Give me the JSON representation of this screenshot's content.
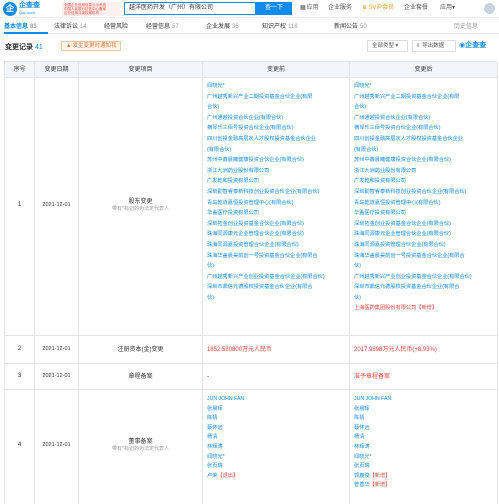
{
  "header": {
    "logo_mark": "企",
    "logo_name": "企查查",
    "logo_site": "Qcc.com",
    "badge_lines": [
      "全国企业信用信息公示系统",
      "中国人民银行征信中心备案",
      "企业信用评级权威机构"
    ],
    "search_value": "越洋医药开发（广州）有限公司",
    "search_button": "查一下",
    "nav": [
      "应用",
      "企业服务",
      "SVIP会员",
      "企业套餐",
      "应用"
    ],
    "nav_icons": {
      "app": "grid-icon",
      "svip": "crown-icon"
    }
  },
  "tabs": [
    {
      "label": "基本信息",
      "count": "83"
    },
    {
      "label": "法律诉讼",
      "count": "14"
    },
    {
      "label": "经营风险",
      "count": ""
    },
    {
      "label": "经营信息",
      "count": "57"
    },
    {
      "label": "企业发展",
      "count": "36"
    },
    {
      "label": "知识产权",
      "count": "118"
    },
    {
      "label": "新闻公告",
      "count": "50"
    },
    {
      "label": "历史信息",
      "count": ""
    }
  ],
  "section": {
    "title": "变更记录",
    "count": "41",
    "hint": "发生变更时通知我",
    "filter": "全部类型",
    "export": "导出数据",
    "brand": "企查查"
  },
  "table": {
    "headers": [
      "序号",
      "变更日期",
      "变更项目",
      "变更前",
      "变更后"
    ],
    "rows": [
      {
        "seq": "1",
        "date": "2021-12-01",
        "item": "股东变更",
        "item_note": "带有*标记的为法定代表人",
        "before": [
          {
            "text": "闻晓光*"
          },
          {
            "text": "广州越秀新兴产业二期投资基金合伙企业(有限"
          },
          {
            "text": "合伙)"
          },
          {
            "text": "广州通越投资合伙企业(有限合伙)"
          },
          {
            "text": "横琴乐三佰号投资合伙企业(有限合伙)"
          },
          {
            "text": "四川创投金融高层次人才股权投资基金合伙企业"
          },
          {
            "text": "(有限合伙)"
          },
          {
            "text": "苏州中鑫晨曦健康投资合伙企业(有限合伙)"
          },
          {
            "text": "浙江九洲药业股份有限公司"
          },
          {
            "text": "广发乾和投资有限公司"
          },
          {
            "text": "深圳勤智睿泰新科技创业投资合伙企业(有限合伙)"
          },
          {
            "text": "青岛乾道嘉恒投资管理中心(有限合伙)"
          },
          {
            "text": "华盖医疗投资有限公司"
          },
          {
            "text": "深圳拓金创业投资基金合伙企业(有限合伙)"
          },
          {
            "text": "珠海同源康元企业管理合伙企业(有限合伙)"
          },
          {
            "text": "珠海同源嘉投资管理合伙企业(有限合伙)"
          },
          {
            "text": "珠海华盖晨昊前创一号投资基金合伙企业(有限合"
          },
          {
            "text": "伙)"
          },
          {
            "text": "广州越秀新兴产业创业投资基金合伙企业(有限合伙)"
          },
          {
            "text": "深圳市鼎信元德股权投资基金合伙企业(有限合"
          },
          {
            "text": "伙)"
          }
        ],
        "after": [
          {
            "text": "闻晓光*"
          },
          {
            "text": "广州越秀新兴产业二期投资基金合伙企业(有限"
          },
          {
            "text": "合伙)"
          },
          {
            "text": "广州通越投资合伙企业(有限合伙)"
          },
          {
            "text": "横琴乐三佰号投资合伙企业(有限合伙)"
          },
          {
            "text": "四川创投金融高层次人才股权投资基金合伙企业"
          },
          {
            "text": "(有限合伙)"
          },
          {
            "text": "苏州中鑫晨曦健康投资合伙企业(有限合伙)"
          },
          {
            "text": "浙江九洲药业股份有限公司"
          },
          {
            "text": "广发乾和投资有限公司"
          },
          {
            "text": "深圳勤智睿泰新科技创业投资合伙企业(有限合伙)"
          },
          {
            "text": "青岛乾道嘉恒投资管理中心(有限合伙)"
          },
          {
            "text": "华盖医疗投资有限公司"
          },
          {
            "text": "深圳拓金创业投资基金合伙企业(有限合伙)"
          },
          {
            "text": "珠海同源康元企业管理合伙企业(有限合伙)"
          },
          {
            "text": "珠海同源嘉投资管理合伙企业(有限合伙)"
          },
          {
            "text": "珠海华盖晨昊前创一号投资基金合伙企业(有限合"
          },
          {
            "text": "伙)"
          },
          {
            "text": "广州越秀新兴产业创业投资基金合伙企业(有限合伙)"
          },
          {
            "text": "深圳市鼎信元德股权投资基金合伙企业(有限合"
          },
          {
            "text": "伙)"
          },
          {
            "text": "上海医药集团股份有限公司",
            "tag": "【新增】",
            "red": true
          }
        ]
      },
      {
        "seq": "2",
        "date": "2021-12-01",
        "item": "注册资本(金)变更",
        "before_text": "1852.580800万元人民币",
        "after_text": "2017.9898万元人民币(+8.93%)"
      },
      {
        "seq": "3",
        "date": "2021-12-01",
        "item": "章程备案",
        "before_text": "-",
        "after_text": "准予章程备案"
      },
      {
        "seq": "4",
        "date": "2021-12-01",
        "item": "董事备案",
        "item_note": "带有*标记的为法定代表人",
        "before": [
          {
            "text": "JUN JOHN FAN"
          },
          {
            "text": "张晨晖"
          },
          {
            "text": "陈猜"
          },
          {
            "text": "蔡怀远"
          },
          {
            "text": "杨清"
          },
          {
            "text": "林辉涛"
          },
          {
            "text": "闻晓光*"
          },
          {
            "text": "张页瑞"
          },
          {
            "text": "卢荣",
            "tag": "【退出】"
          }
        ],
        "after": [
          {
            "text": "JUN JOHN FAN"
          },
          {
            "text": "张晨晖"
          },
          {
            "text": "陈猜"
          },
          {
            "text": "蔡怀远"
          },
          {
            "text": "杨清"
          },
          {
            "text": "林辉涛"
          },
          {
            "text": "闻晓光*"
          },
          {
            "text": "张页瑞"
          },
          {
            "text": "郭鹿俊",
            "tag": "【新增】"
          },
          {
            "text": "曾善华",
            "tag": "【新增】"
          }
        ]
      }
    ]
  }
}
